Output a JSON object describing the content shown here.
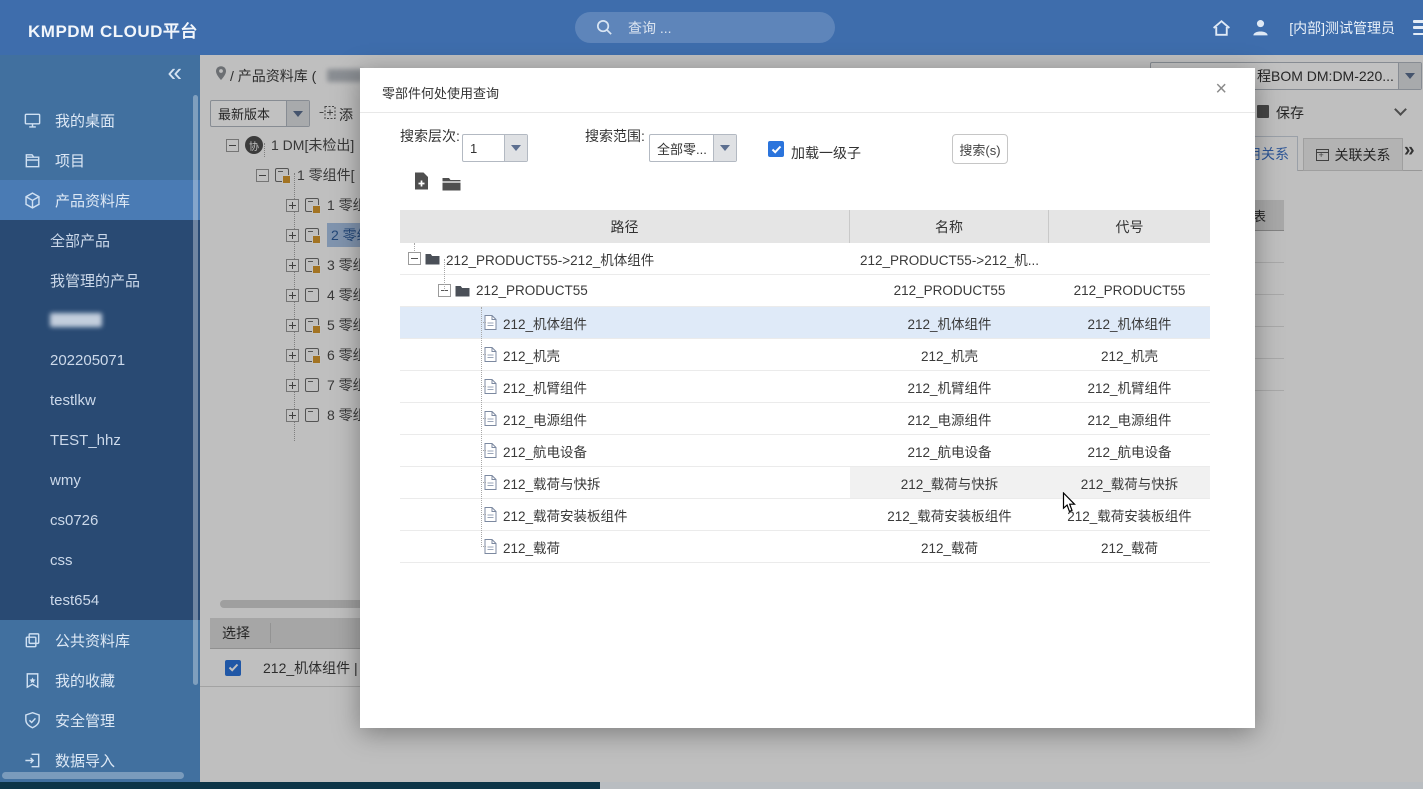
{
  "header": {
    "logo": "KMPDM CLOUD平台",
    "search_placeholder": "查询 ...",
    "user_label": "[内部]测试管理员"
  },
  "sidebar": {
    "collapse_icon": "«",
    "items_top": [
      {
        "id": "desktop",
        "label": "我的桌面"
      },
      {
        "id": "project",
        "label": "项目"
      },
      {
        "id": "product-library",
        "label": "产品资料库",
        "active": true
      }
    ],
    "submenu": [
      {
        "label": "全部产品"
      },
      {
        "label": "我管理的产品"
      },
      {
        "blurred": true
      },
      {
        "label": "202205071"
      },
      {
        "label": "testlkw"
      },
      {
        "label": "TEST_hhz"
      },
      {
        "label": "wmy"
      },
      {
        "label": "cs0726"
      },
      {
        "label": "css"
      },
      {
        "label": "test654"
      }
    ],
    "items_bottom": [
      {
        "id": "public-library",
        "label": "公共资料库"
      },
      {
        "id": "favorites",
        "label": "我的收藏"
      },
      {
        "id": "security",
        "label": "安全管理"
      },
      {
        "id": "data-import",
        "label": "数据导入"
      }
    ]
  },
  "background": {
    "breadcrumb": "/ 产品资料库 (",
    "version_select": "最新版本",
    "add_label": "添",
    "tree": {
      "root": {
        "badge": "协",
        "label": "1 DM[未检出]"
      },
      "child": {
        "label": "1 零组件["
      },
      "items": [
        {
          "num": "1",
          "label": "零组",
          "orange": true
        },
        {
          "num": "2",
          "label": "零组",
          "orange": true,
          "selected": true
        },
        {
          "num": "3",
          "label": "零组",
          "orange": true
        },
        {
          "num": "4",
          "label": "零组",
          "orange": false
        },
        {
          "num": "5",
          "label": "零组",
          "orange": true
        },
        {
          "num": "6",
          "label": "零组",
          "orange": true
        },
        {
          "num": "7",
          "label": "零组",
          "orange": false
        },
        {
          "num": "8",
          "label": "零组",
          "orange": false
        }
      ]
    },
    "bottom": {
      "select_header": "选择",
      "row_label": "212_机体组件 |",
      "checkbox_checked": true
    },
    "right": {
      "bom_select": "程BOM DM:DM-220...",
      "save_label": "保存",
      "tab_active": "用关系",
      "tab_related": "关联关系",
      "tab_overflow": "»",
      "panel_header": "表",
      "empty_row_count": 5
    }
  },
  "modal": {
    "title": "零部件何处使用查询",
    "close": "×",
    "form": {
      "level_label": "搜索层次:",
      "level_value": "1",
      "scope_label": "搜索范围:",
      "scope_value": "全部零...",
      "load_children_label": "加载一级子",
      "load_children_checked": true,
      "search_button": "搜索(s)"
    },
    "toolbar_icons": [
      "add-file-icon",
      "open-folder-icon"
    ],
    "table": {
      "columns": [
        "路径",
        "名称",
        "代号"
      ],
      "rows": [
        {
          "path": "212_PRODUCT55->212_机体组件",
          "name": "212_PRODUCT55->212_机...",
          "code": "",
          "level": 0,
          "type": "folder"
        },
        {
          "path": "212_PRODUCT55",
          "name": "212_PRODUCT55",
          "code": "212_PRODUCT55",
          "level": 1,
          "type": "folder"
        },
        {
          "path": "212_机体组件",
          "name": "212_机体组件",
          "code": "212_机体组件",
          "level": 2,
          "type": "doc",
          "selected": true
        },
        {
          "path": "212_机壳",
          "name": "212_机壳",
          "code": "212_机壳",
          "level": 2,
          "type": "doc"
        },
        {
          "path": "212_机臂组件",
          "name": "212_机臂组件",
          "code": "212_机臂组件",
          "level": 2,
          "type": "doc"
        },
        {
          "path": "212_电源组件",
          "name": "212_电源组件",
          "code": "212_电源组件",
          "level": 2,
          "type": "doc"
        },
        {
          "path": "212_航电设备",
          "name": "212_航电设备",
          "code": "212_航电设备",
          "level": 2,
          "type": "doc"
        },
        {
          "path": "212_载荷与快拆",
          "name": "212_载荷与快拆",
          "code": "212_载荷与快拆",
          "level": 2,
          "type": "doc",
          "hover": true
        },
        {
          "path": "212_载荷安装板组件",
          "name": "212_载荷安装板组件",
          "code": "212_载荷安装板组件",
          "level": 2,
          "type": "doc"
        },
        {
          "path": "212_载荷",
          "name": "212_载荷",
          "code": "212_载荷",
          "level": 2,
          "type": "doc"
        }
      ]
    }
  },
  "colors": {
    "header_blue": "#3e6dac",
    "sidebar_blue": "#41709f",
    "sidebar_active": "#4a7bb4",
    "submenu_bg": "#294a73",
    "checkbox_blue": "#2b74dc",
    "selected_row": "#dfeaf8",
    "tree_badge_orange": "#d6992e"
  }
}
